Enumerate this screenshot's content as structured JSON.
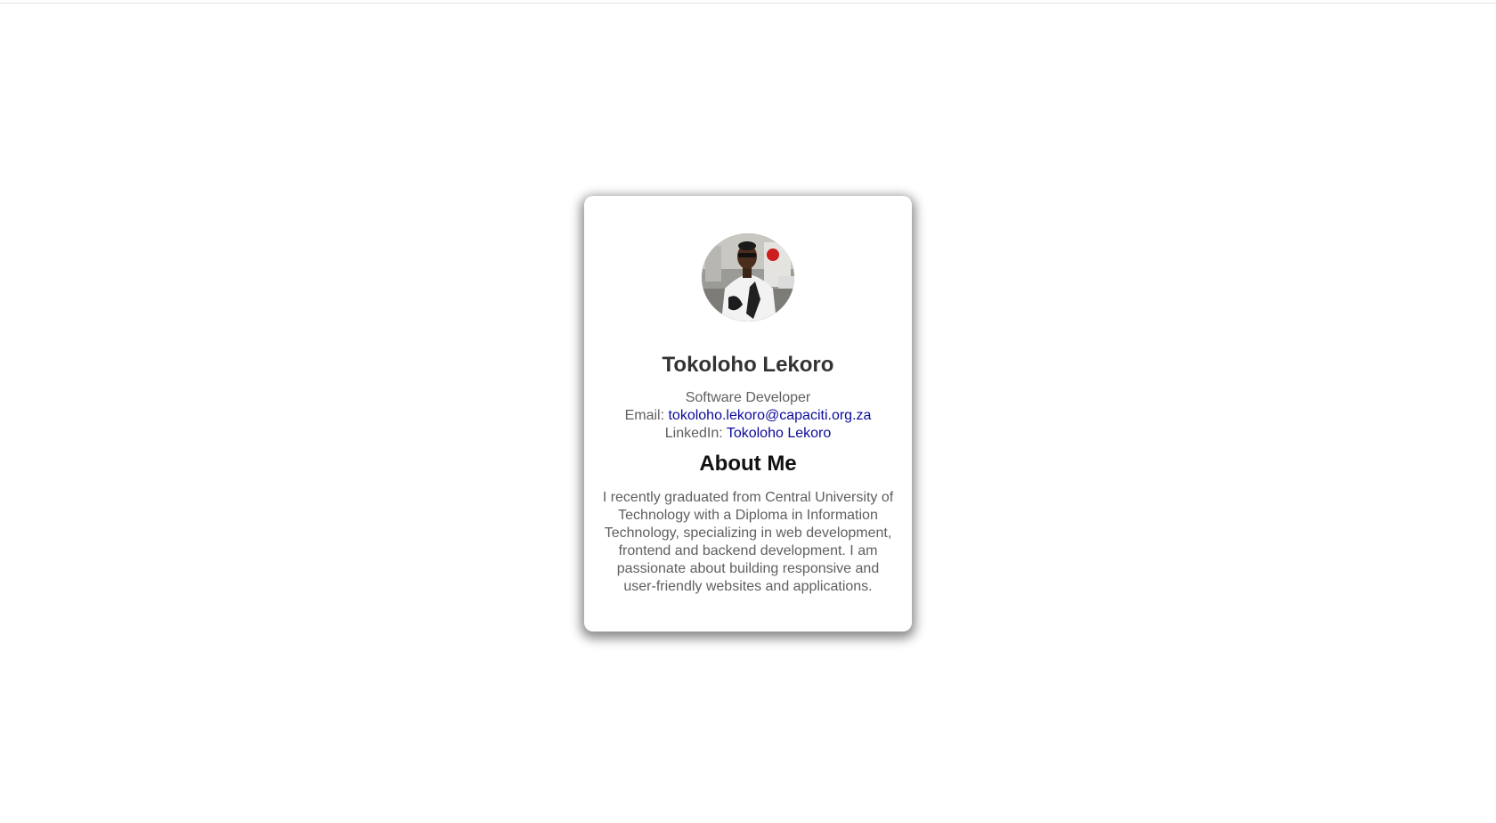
{
  "profile": {
    "name": "Tokoloho Lekoro",
    "role": "Software Developer",
    "email_label": "Email:",
    "email": "tokoloho.lekoro@capaciti.org.za",
    "linkedin_label": "LinkedIn:",
    "linkedin_text": "Tokoloho Lekoro"
  },
  "about": {
    "title": "About Me",
    "text": "I recently graduated from Central University of Technology with a Diploma in Information Technology, specializing in web development, frontend and backend development. I am passionate about building responsive and user-friendly websites and applications."
  },
  "colors": {
    "link": "#0a0a9a",
    "body_text": "#5f5f5f",
    "heading": "#333333"
  }
}
